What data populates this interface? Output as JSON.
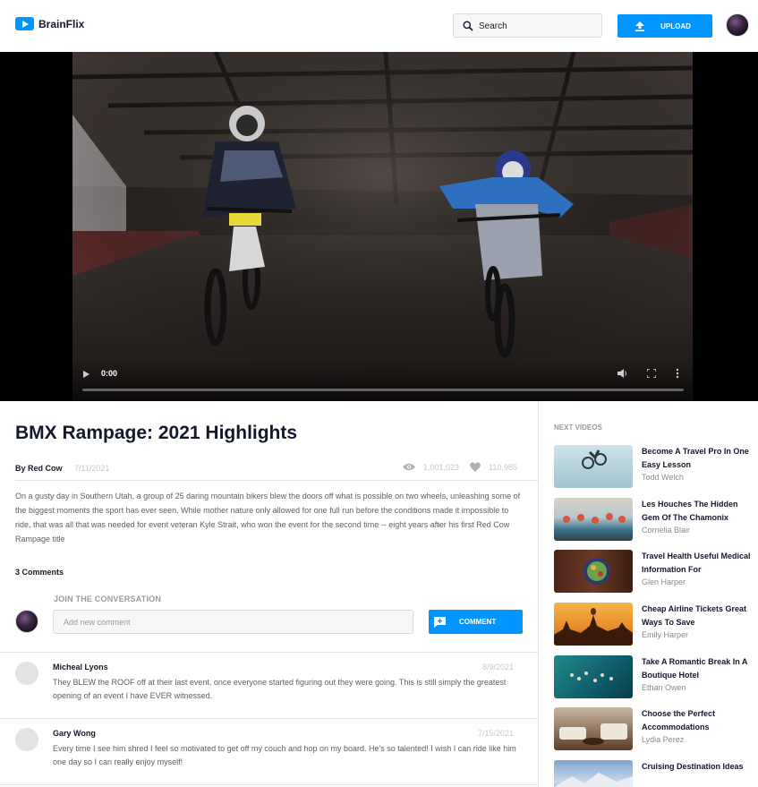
{
  "app": {
    "name": "BrainFlix",
    "brand_color": "#0095ff"
  },
  "header": {
    "search_placeholder": "Search",
    "upload_label": "UPLOAD"
  },
  "player": {
    "time": "0:00"
  },
  "video": {
    "title": "BMX Rampage: 2021 Highlights",
    "byline": "By Red Cow",
    "date": "7/11/2021",
    "views": "1,001,023",
    "likes": "110,985",
    "description": "On a gusty day in Southern Utah, a group of 25 daring mountain bikers blew the doors off what is possible on two wheels, unleashing some of the biggest moments the sport has ever seen. While mother nature only allowed for one full run before the conditions made it impossible to ride, that was all that was needed for event veteran Kyle Strait, who won the event for the second time -- eight years after his first Red Cow Rampage title"
  },
  "comments": {
    "count_label": "3 Comments",
    "join_label": "JOIN THE CONVERSATION",
    "input_placeholder": "Add new comment",
    "button_label": "COMMENT",
    "items": [
      {
        "name": "Micheal Lyons",
        "date": "8/9/2021",
        "text": "They BLEW the ROOF off at their last event, once everyone started figuring out they were going. This is still simply the greatest opening of an event I have EVER witnessed."
      },
      {
        "name": "Gary Wong",
        "date": "7/15/2021",
        "text": "Every time I see him shred I feel so motivated to get off my couch and hop on my board. He's so talented! I wish I can ride like him one day so I can really enjoy myself!"
      }
    ]
  },
  "sidebar": {
    "heading": "NEXT VIDEOS",
    "videos": [
      {
        "title": "Become A Travel Pro In One Easy Lesson",
        "author": "Todd Welch"
      },
      {
        "title": "Les Houches The Hidden Gem Of The Chamonix",
        "author": "Cornelia Blair"
      },
      {
        "title": "Travel Health Useful Medical Information For",
        "author": "Glen Harper"
      },
      {
        "title": "Cheap Airline Tickets Great Ways To Save",
        "author": "Emily Harper"
      },
      {
        "title": "Take A Romantic Break In A Boutique Hotel",
        "author": "Ethan Owen"
      },
      {
        "title": "Choose the Perfect Accommodations",
        "author": "Lydia Perez"
      },
      {
        "title": "Cruising Destination Ideas",
        "author": ""
      }
    ]
  }
}
